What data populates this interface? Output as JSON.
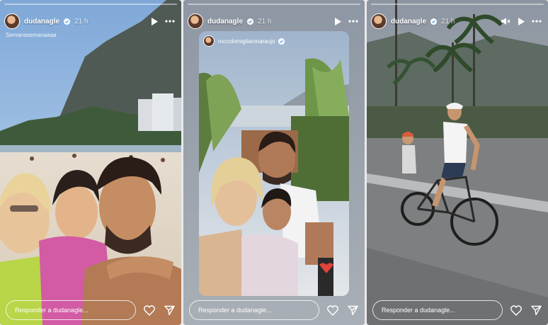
{
  "stories": [
    {
      "username": "dudanagle",
      "time": "21 h",
      "subtitle": "Semanasemanaaaa",
      "reply_placeholder": "Responder a dudanagle..."
    },
    {
      "username": "dudanagle",
      "time": "21 h",
      "shared_username": "roccolomigliaronaraujo",
      "reply_placeholder": "Responder a dudanagle..."
    },
    {
      "username": "dudanagle",
      "time": "21 h",
      "reply_placeholder": "Responder a dudanagle..."
    }
  ],
  "icons": {
    "play": "play-icon",
    "more": "more-options-icon",
    "heart": "heart-icon",
    "send": "send-icon",
    "verified": "verified-badge-icon"
  }
}
